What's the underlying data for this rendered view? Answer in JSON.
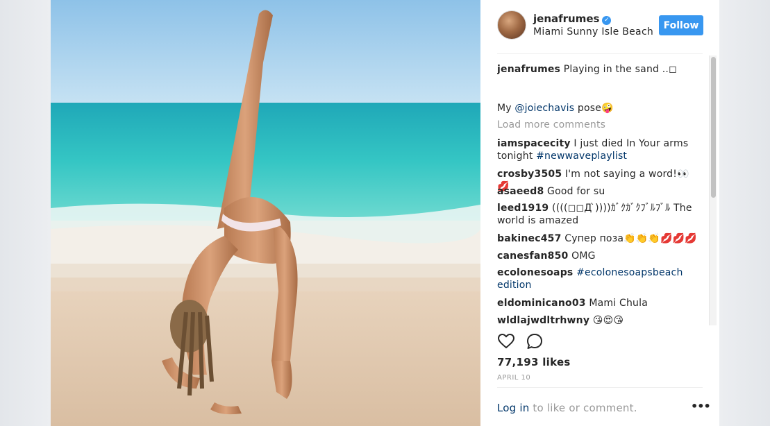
{
  "post": {
    "username": "jenafrumes",
    "location": "Miami Sunny Isle Beach",
    "follow_label": "Follow",
    "caption_user": "jenafrumes",
    "caption_text": "Playing in the sand ..◻",
    "caption_line2_prefix": "My ",
    "caption_mention": "@joiechavis",
    "caption_line2_suffix": " pose🤪",
    "load_more": "Load more comments",
    "likes": "77,193 likes",
    "date": "APRIL 10",
    "login_link": "Log in",
    "login_suffix": " to like or comment.",
    "more_options": "•••"
  },
  "comments": [
    {
      "user": "iamspacecity",
      "text": " I just died In Your arms tonight ",
      "tag": "#newwaveplaylist"
    },
    {
      "user": "crosby3505",
      "text": " I'm not saying a word!👀💋",
      "tag": ""
    },
    {
      "user": "asaeed8",
      "text": " Good for su",
      "tag": ""
    },
    {
      "user": "leed1919",
      "text": " ((((◻◻Д ̀))))ｶﾞｸｶﾞｸﾌﾞﾙﾌﾞﾙ The world is amazed",
      "tag": ""
    },
    {
      "user": "bakinec457",
      "text": " Супер поза👏👏👏💋💋💋",
      "tag": ""
    },
    {
      "user": "canesfan850",
      "text": " OMG",
      "tag": ""
    },
    {
      "user": "ecolonesoaps",
      "text": " ",
      "tag": "#ecolonesoapsbeachedition"
    },
    {
      "user": "eldominicano03",
      "text": " Mami Chula",
      "tag": ""
    },
    {
      "user": "wldlajwdltrhwny",
      "text": " 😘😍😘",
      "tag": ""
    }
  ],
  "icons": {
    "like": "heart-outline-icon",
    "comment": "speech-bubble-icon",
    "more": "ellipsis-icon"
  },
  "colors": {
    "accent": "#3897f0",
    "link": "#003569",
    "muted": "#999999"
  }
}
